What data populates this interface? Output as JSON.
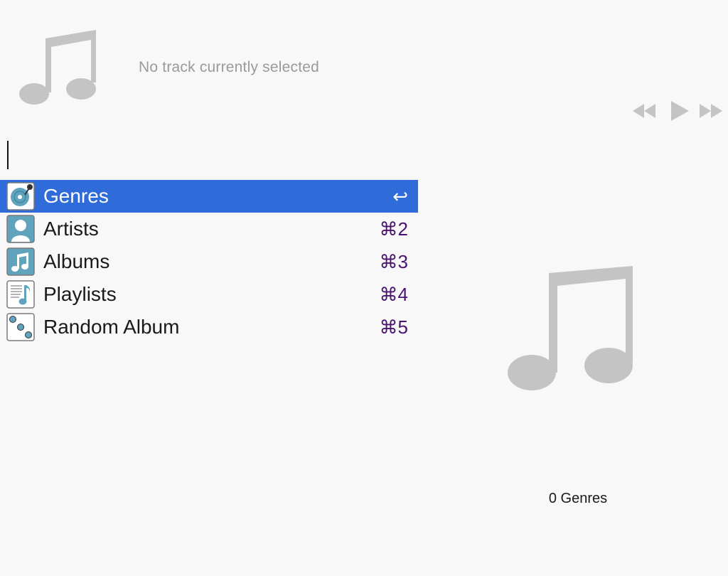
{
  "now_playing": {
    "status_text": "No track currently selected",
    "artwork_icon": "music-note-icon"
  },
  "transport": {
    "previous_icon": "rewind-icon",
    "play_icon": "play-icon",
    "next_icon": "fast-forward-icon"
  },
  "search": {
    "value": ""
  },
  "menu": {
    "items": [
      {
        "label": "Genres",
        "shortcut": "↩",
        "icon": "turntable-icon",
        "selected": true
      },
      {
        "label": "Artists",
        "shortcut": "⌘2",
        "icon": "person-icon",
        "selected": false
      },
      {
        "label": "Albums",
        "shortcut": "⌘3",
        "icon": "music-note-icon",
        "selected": false
      },
      {
        "label": "Playlists",
        "shortcut": "⌘4",
        "icon": "playlist-icon",
        "selected": false
      },
      {
        "label": "Random Album",
        "shortcut": "⌘5",
        "icon": "dice-icon",
        "selected": false
      }
    ]
  },
  "details": {
    "artwork_icon": "music-note-icon",
    "count_text": "0 Genres"
  },
  "colors": {
    "selection": "#2f6bd9",
    "shortcut": "#4a1370",
    "icon_tile": "#5fa3bd"
  }
}
